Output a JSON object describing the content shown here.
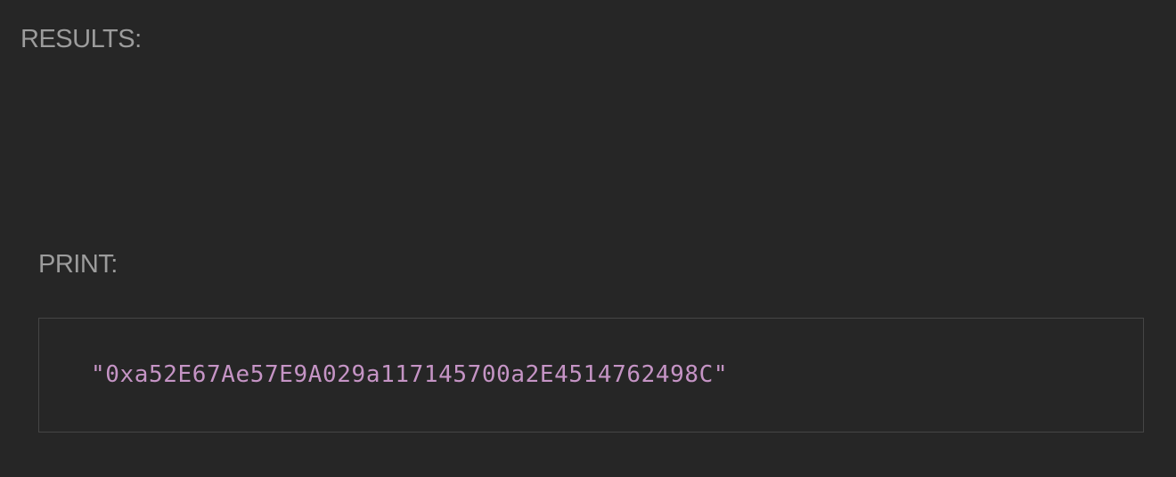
{
  "results": {
    "label": "RESULTS:"
  },
  "print": {
    "label": "PRINT:",
    "value": "\"0xa52E67Ae57E9A029a117145700a2E4514762498C\""
  },
  "colors": {
    "background": "#262626",
    "heading_text": "#9c9c9c",
    "box_border": "#454545",
    "value_text": "#c594c5"
  }
}
